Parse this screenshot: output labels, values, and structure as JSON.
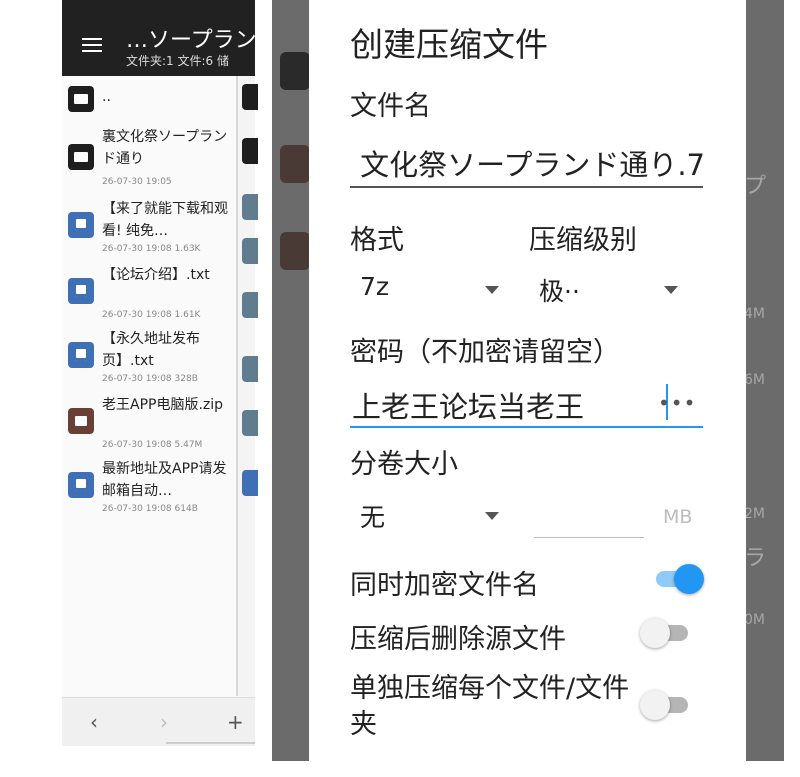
{
  "file_manager": {
    "title": "…ソープラン",
    "subtitle": "文件夹:1  文件:6  储",
    "items": [
      {
        "type": "folder",
        "name": "..",
        "meta": ""
      },
      {
        "type": "folder",
        "name": "裏文化祭ソープランド通り",
        "meta": "26-07-30 19:05"
      },
      {
        "type": "doc",
        "name": "【来了就能下载和观看! 纯免…",
        "meta": "26-07-30 19:08  1.63K"
      },
      {
        "type": "doc",
        "name": "【论坛介绍】.txt",
        "meta": "26-07-30 19:08  1.61K"
      },
      {
        "type": "doc",
        "name": "【永久地址发布页】.txt",
        "meta": "26-07-30 19:08  328B"
      },
      {
        "type": "zip",
        "name": "老王APP电脑版.zip",
        "meta": "26-07-30 19:08  5.47M"
      },
      {
        "type": "doc",
        "name": "最新地址及APP请发邮箱自动…",
        "meta": "26-07-30 19:08  614B"
      }
    ],
    "bottom_nav": {
      "back": "‹",
      "forward": "›",
      "add": "+"
    }
  },
  "background_hints": {
    "texts": [
      "プ",
      "4M",
      "6M",
      "2M",
      "ラ",
      "0M"
    ]
  },
  "dialog": {
    "title": "创建压缩文件",
    "filename_label": "文件名",
    "filename_value": "文化祭ソープランド通り.7",
    "format_label": "格式",
    "format_value": "7z",
    "level_label": "压缩级别",
    "level_value": "极··",
    "password_label": "密码（不加密请留空）",
    "password_value": "上老王论坛当老王",
    "password_more": "•••",
    "split_label": "分卷大小",
    "split_value": "无",
    "split_unit": "MB",
    "encrypt_names_label": "同时加密文件名",
    "encrypt_names_on": true,
    "delete_source_label": "压缩后删除源文件",
    "delete_source_on": false,
    "separate_label": "单独压缩每个文件/文件夹",
    "separate_on": false
  }
}
